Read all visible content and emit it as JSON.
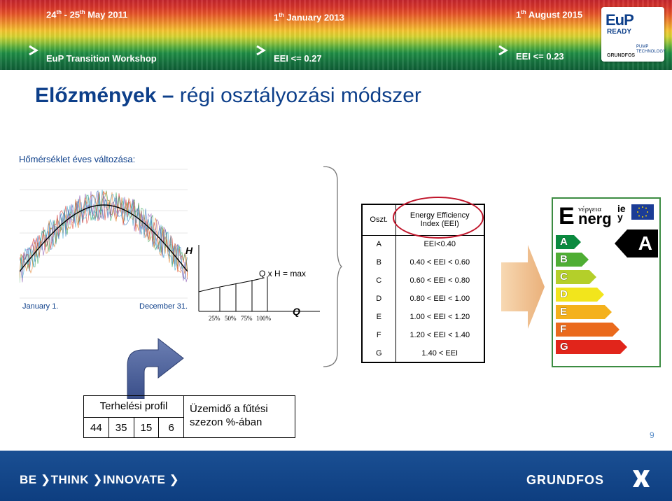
{
  "header": {
    "date_event": "24",
    "date_event_sup1": "th",
    "date_event_mid": " - 25",
    "date_event_sup2": "th",
    "date_event_end": " May 2011",
    "workshop": "EuP Transition Workshop",
    "date_2013_day": "1",
    "date_2013_sup": "th",
    "date_2013_rest": " January 2013",
    "eei_2013": "EEI <= 0.27",
    "date_2015_day": "1",
    "date_2015_sup": "th",
    "date_2015_rest": " August 2015",
    "eei_2015": "EEI <= 0.23",
    "logo": {
      "eup": "EuP",
      "ready": "READY",
      "pump": "PUMP",
      "technology": "TECHNOLOGY",
      "grundfos": "GRUNDFOS"
    }
  },
  "title": {
    "bold": "Előzmények –",
    "rest": " régi osztályozási módszer"
  },
  "subtitle": "Hőmérséklet éves változása:",
  "temp_chart": {
    "x_start": "January 1.",
    "x_end": "December 31."
  },
  "pump_chart": {
    "y_label": "H",
    "x_label": "Q",
    "curve_label": "Q x H = max",
    "percents": [
      "25%",
      "50%",
      "75%",
      "100%"
    ]
  },
  "eei_table": {
    "head_class": "Oszt.",
    "head_index_line1": "Energy Efficiency",
    "head_index_line2": "Index (EEI)",
    "rows": [
      {
        "cls": "A",
        "range": "EEI<0.40"
      },
      {
        "cls": "B",
        "range": "0.40 < EEI < 0.60"
      },
      {
        "cls": "C",
        "range": "0.60 < EEI < 0.80"
      },
      {
        "cls": "D",
        "range": "0.80 < EEI < 1.00"
      },
      {
        "cls": "E",
        "range": "1.00 < EEI < 1.20"
      },
      {
        "cls": "F",
        "range": "1.20 < EEI < 1.40"
      },
      {
        "cls": "G",
        "range": "1.40 < EEI"
      }
    ]
  },
  "energy_label": {
    "e": "E",
    "greek": "νέργεια",
    "energ": "nerg",
    "iey_1": "ie",
    "iey_2": "y",
    "classes": [
      "A",
      "B",
      "C",
      "D",
      "E",
      "F",
      "G"
    ],
    "colors": [
      "#0b8a3f",
      "#4fae34",
      "#b4cf2a",
      "#f2e51c",
      "#f4b11c",
      "#ea6a1d",
      "#e1251b"
    ],
    "rating": "A"
  },
  "load_profile": {
    "title": "Terhelési profil",
    "values": [
      "44",
      "35",
      "15",
      "6"
    ],
    "desc_line1": "Üzemidő a fűtési",
    "desc_line2": "szezon %-ában"
  },
  "page_number": "9",
  "footer": {
    "left": "BE ❯THINK ❯INNOVATE ❯",
    "right": "GRUNDFOS"
  }
}
